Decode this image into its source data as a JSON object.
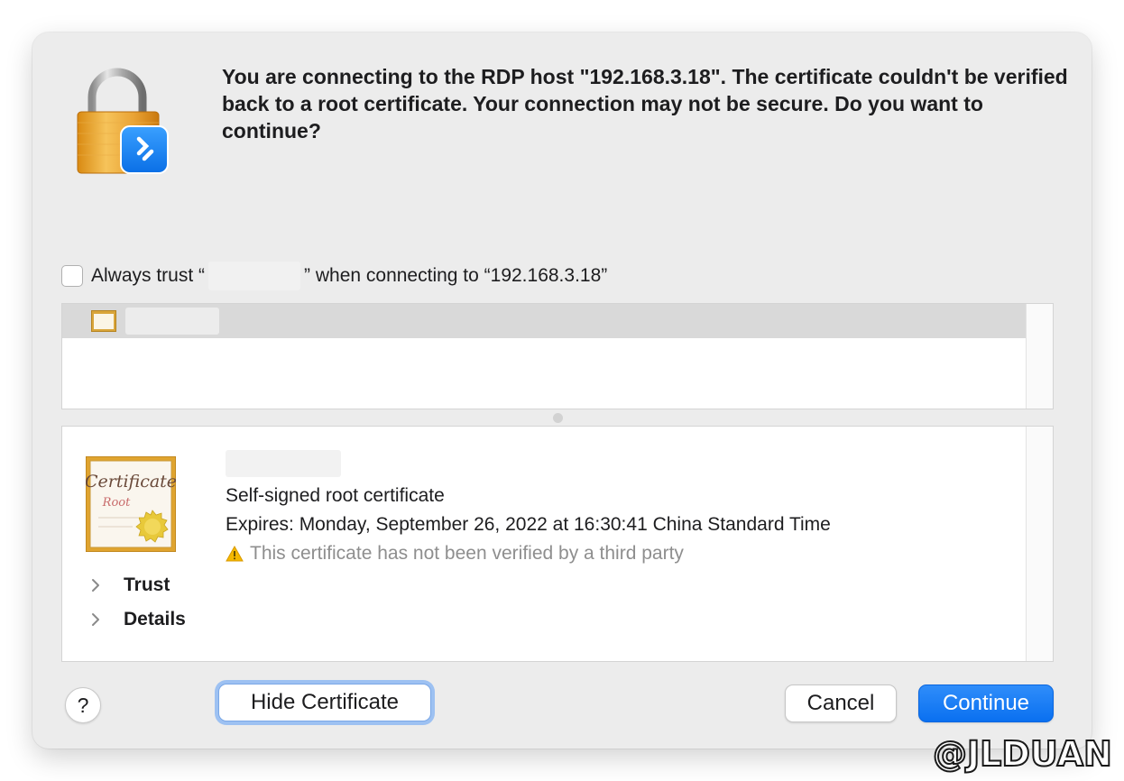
{
  "dialog": {
    "message": "You are connecting to the RDP host \"192.168.3.18\". The certificate couldn't be verified back to a root certificate. Your connection may not be secure. Do you want to continue?",
    "app_icon": "padlock-remote-desktop-icon"
  },
  "trust": {
    "checked": false,
    "prefix": "Always trust “",
    "suffix": "” when connecting to “192.168.3.18”"
  },
  "certificate_list": {
    "items": [
      {
        "icon": "certificate-icon",
        "selected": true
      }
    ]
  },
  "certificate": {
    "icon": "certificate-large-icon",
    "icon_text": {
      "title": "Certificate",
      "subtitle": "Root"
    },
    "type": "Self-signed root certificate",
    "expires": "Expires: Monday, September 26, 2022 at 16:30:41 China Standard Time",
    "warning": "This certificate has not been verified by a third party",
    "warning_icon": "warning-triangle-icon"
  },
  "sections": [
    {
      "label": "Trust",
      "expanded": false
    },
    {
      "label": "Details",
      "expanded": false
    }
  ],
  "buttons": {
    "help": "?",
    "hide_certificate": "Hide Certificate",
    "cancel": "Cancel",
    "continue": "Continue"
  },
  "watermark": "@JLDUAN",
  "colors": {
    "accent": "#0a70f0",
    "warning": "#f5b800",
    "focus_ring": "#9dc1f2"
  }
}
